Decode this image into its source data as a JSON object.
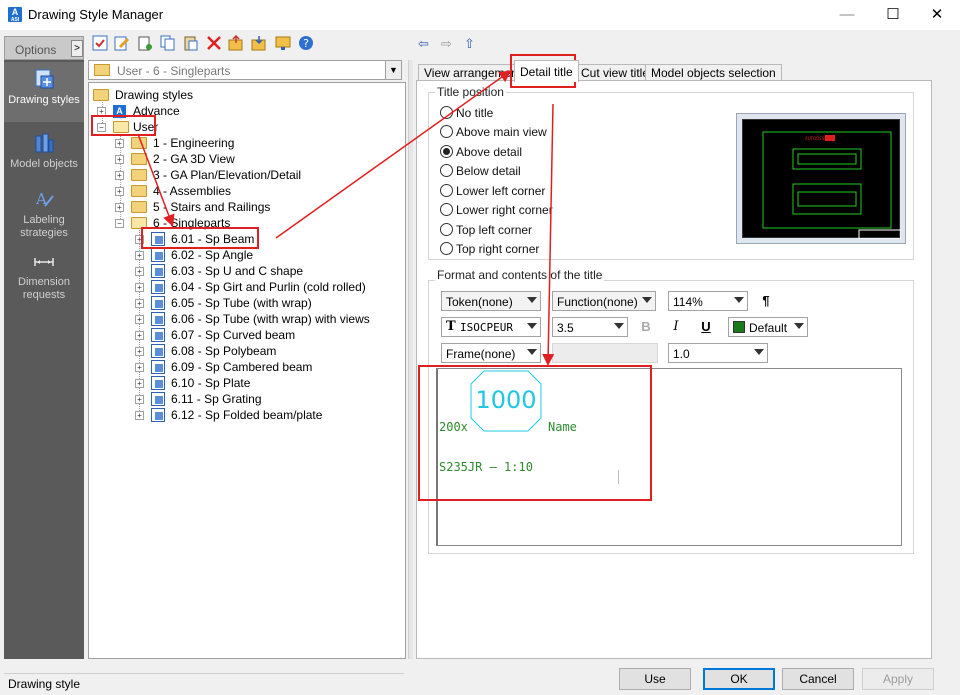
{
  "window": {
    "title": "Drawing Style Manager",
    "app_icon_letter": "A",
    "app_icon_sub": "ASI",
    "minimize": "—",
    "maximize": "☐",
    "close": "✕"
  },
  "sidebar": {
    "options_label": "Options",
    "options_arrow": ">",
    "items": [
      {
        "label_line1": "Drawing styles",
        "label_line2": "",
        "icon": "drawing-styles-icon",
        "active": true
      },
      {
        "label_line1": "Model objects",
        "label_line2": "",
        "icon": "model-objects-icon",
        "active": false
      },
      {
        "label_line1": "Labeling",
        "label_line2": "strategies",
        "icon": "labeling-strategies-icon",
        "active": false
      },
      {
        "label_line1": "Dimension",
        "label_line2": "requests",
        "icon": "dimension-requests-icon",
        "active": false
      }
    ]
  },
  "toolbar": {
    "icons": [
      "check-icon",
      "edit-icon",
      "new-icon",
      "copy-icon",
      "paste-icon",
      "delete-icon",
      "folder-export-icon",
      "folder-import-icon",
      "preview-icon",
      "help-icon"
    ]
  },
  "tree": {
    "selector_value": "User - 6 - Singleparts",
    "root": "Drawing styles",
    "advance": "Advance",
    "user": "User",
    "expand_plus": "+",
    "collapse_minus": "−",
    "groups": [
      "1 - Engineering",
      "2 - GA 3D View",
      "3 - GA Plan/Elevation/Detail",
      "4 - Assemblies",
      "5 - Stairs and Railings",
      "6 - Singleparts"
    ],
    "singleparts": [
      "6.01 - Sp Beam",
      "6.02 - Sp Angle",
      "6.03 - Sp U and C shape",
      "6.04 - Sp Girt and Purlin (cold rolled)",
      "6.05 - Sp Tube (with wrap)",
      "6.06 - Sp Tube (with wrap) with views",
      "6.07 - Sp Curved beam",
      "6.08 - Sp Polybeam",
      "6.09 - Sp Cambered beam",
      "6.10 - Sp Plate",
      "6.11 - Sp Grating",
      "6.12 - Sp Folded beam/plate"
    ]
  },
  "nav_arrows": {
    "back": "⇦",
    "forward": "⇨",
    "up": "⇧"
  },
  "tabs": [
    "View arrangement",
    "Detail title",
    "Cut view title",
    "Model objects selection"
  ],
  "title_position": {
    "legend": "Title position",
    "options": [
      "No title",
      "Above main view",
      "Above detail",
      "Below detail",
      "Lower left corner",
      "Lower right corner",
      "Top left corner",
      "Top right corner"
    ],
    "selected_index": 2
  },
  "preview": {
    "label": "AUTODESK"
  },
  "format": {
    "legend": "Format and contents of the title",
    "token": "Token(none)",
    "function": "Function(none)",
    "zoom": "114%",
    "pilcrow": "¶",
    "font_glyph": "T",
    "font": "ISOCPEUR",
    "size": "3.5",
    "bold": "B",
    "italic": "I",
    "underline": "U",
    "color_label": "Default",
    "color_swatch": "#1a7a1a",
    "frame": "Frame(none)",
    "ratio": "1.0"
  },
  "editor": {
    "octagon_value": "1000",
    "count": "200x",
    "name": "Name",
    "line2": "S235JR – 1:10"
  },
  "status": {
    "text": "Drawing style"
  },
  "buttons": {
    "use": "Use",
    "ok": "OK",
    "cancel": "Cancel",
    "apply": "Apply"
  },
  "colors": {
    "annotation_red": "#e02020",
    "preview_green": "#22cc22",
    "editor_green": "#2e8b2e",
    "octagon_cyan": "#1ec8e0"
  }
}
